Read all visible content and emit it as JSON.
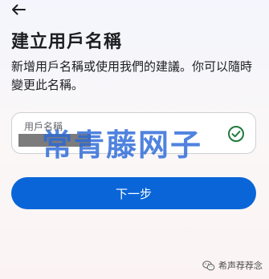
{
  "header": {
    "back_icon": "arrow-left-icon"
  },
  "page": {
    "title": "建立用戶名稱",
    "description": "新增用戶名稱或使用我們的建議。你可以隨時變更此名稱。"
  },
  "username_field": {
    "label": "用戶名稱",
    "value": "",
    "value_redacted": true,
    "status_icon": "check-circle-icon",
    "status_color": "#1f7a3a"
  },
  "actions": {
    "next_label": "下一步",
    "accent_color": "#0a66d8"
  },
  "overlay": {
    "watermark_text": "常青藤网子",
    "credit_text": "希声荐荐念",
    "credit_icon": "wechat-icon"
  }
}
